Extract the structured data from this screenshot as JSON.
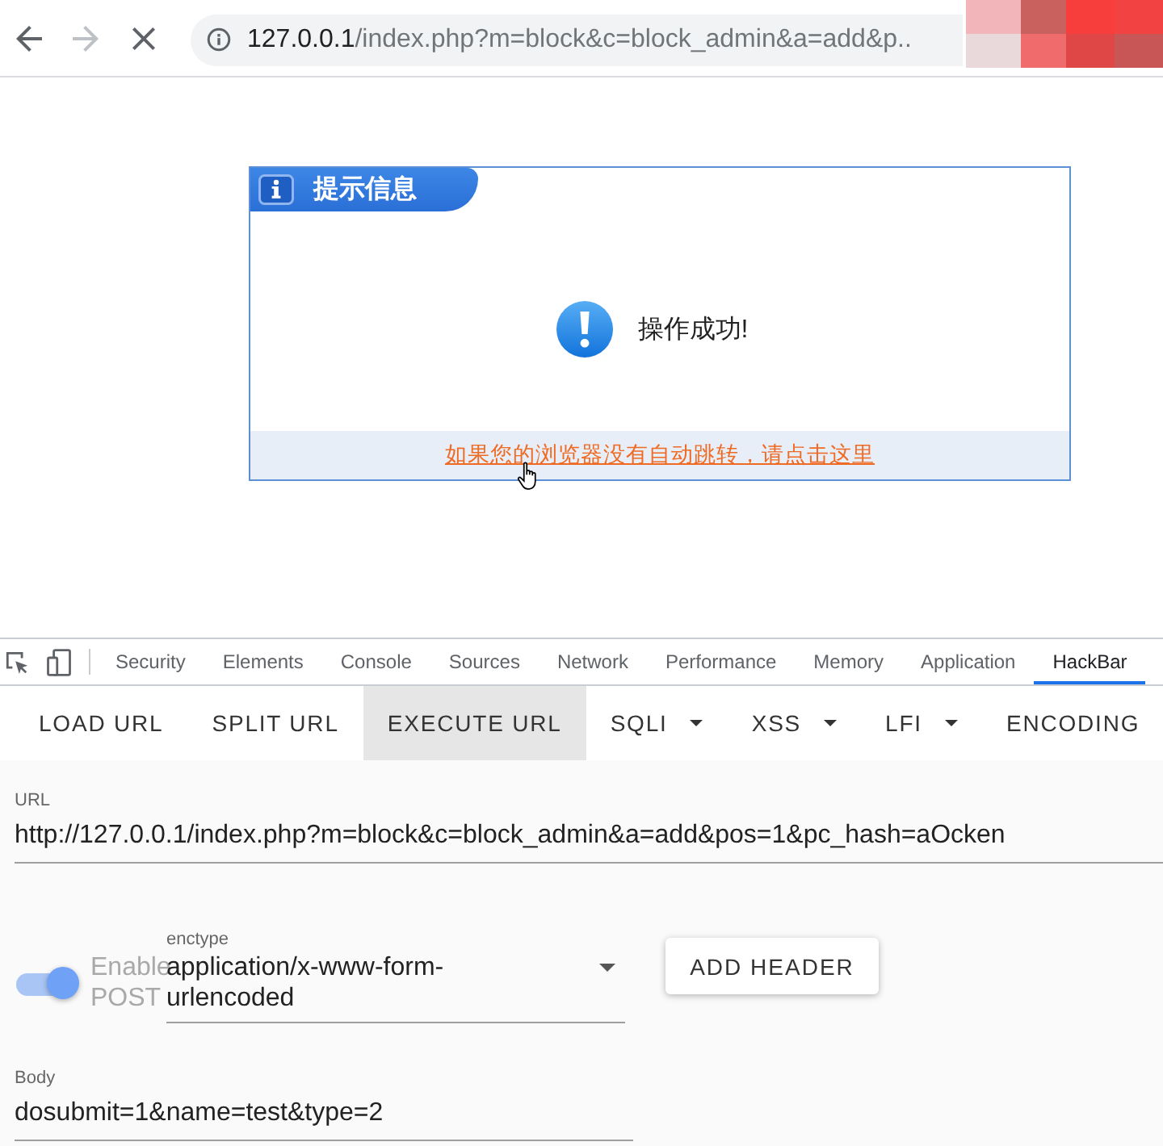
{
  "browser": {
    "nav": [
      {
        "kind": "back",
        "disabled": false
      },
      {
        "kind": "forward",
        "disabled": true
      },
      {
        "kind": "stop",
        "disabled": false
      }
    ],
    "address": {
      "host": "127.0.0.1",
      "path": "/index.php?m=block&c=block_admin&a=add&p.."
    }
  },
  "message": {
    "title": "提示信息",
    "text": "操作成功!",
    "link": "如果您的浏览器没有自动跳转，请点击这里"
  },
  "devtools": {
    "tabs": [
      {
        "label": "Security",
        "selected": false
      },
      {
        "label": "Elements",
        "selected": false
      },
      {
        "label": "Console",
        "selected": false
      },
      {
        "label": "Sources",
        "selected": false
      },
      {
        "label": "Network",
        "selected": false
      },
      {
        "label": "Performance",
        "selected": false
      },
      {
        "label": "Memory",
        "selected": false
      },
      {
        "label": "Application",
        "selected": false
      },
      {
        "label": "HackBar",
        "selected": true
      }
    ]
  },
  "hackbar": {
    "buttons": [
      {
        "label": "LOAD URL",
        "kind": "button",
        "selected": false
      },
      {
        "label": "SPLIT URL",
        "kind": "button",
        "selected": false
      },
      {
        "label": "EXECUTE URL",
        "kind": "button",
        "selected": true
      },
      {
        "label": "SQLI",
        "kind": "dropdown",
        "selected": false
      },
      {
        "label": "XSS",
        "kind": "dropdown",
        "selected": false
      },
      {
        "label": "LFI",
        "kind": "dropdown",
        "selected": false
      },
      {
        "label": "ENCODING",
        "kind": "button",
        "selected": false
      }
    ],
    "url": {
      "label": "URL",
      "value": "http://127.0.0.1/index.php?m=block&c=block_admin&a=add&pos=1&pc_hash=aOcken"
    },
    "post": {
      "label": "Enable POST",
      "on": true
    },
    "enctype": {
      "label": "enctype",
      "value": "application/x-www-form-urlencoded"
    },
    "add_header": "ADD HEADER",
    "body": {
      "label": "Body",
      "value": "dosubmit=1&name=test&type=2"
    }
  }
}
